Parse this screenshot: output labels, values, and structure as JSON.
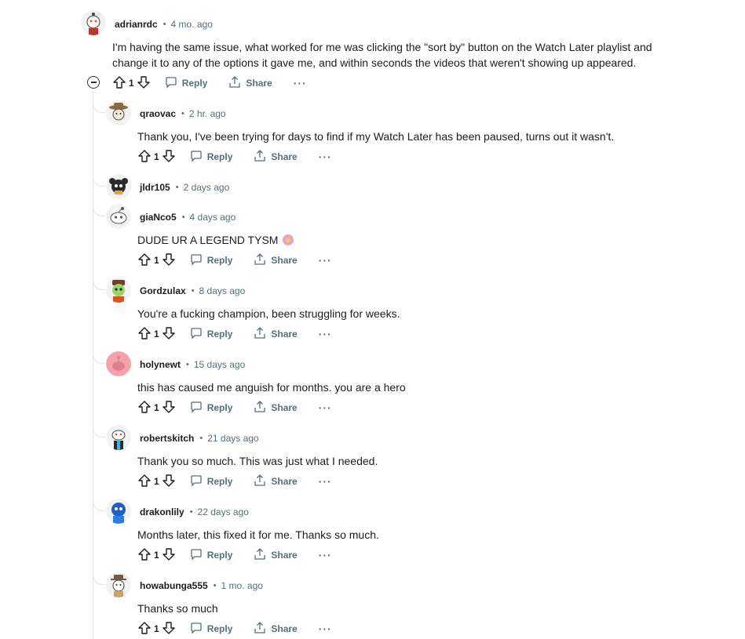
{
  "top_comment": {
    "user": "adrianrdc",
    "time": "4 mo. ago",
    "lines": [
      "I'm having the same issue, what worked for me was clicking the \"sort by\" button on the Watch Later playlist and",
      "change it to any of the options it gave me, and within seconds the videos that weren't showing up appeared."
    ],
    "votes": "1",
    "reply_label": "Reply",
    "share_label": "Share",
    "more_label": "···"
  },
  "replies": [
    {
      "user": "qraovac",
      "time": "2 hr. ago",
      "text": "Thank you, I've been trying for days to find if my Watch Later has been paused, turns out it wasn't.",
      "votes": "1"
    },
    {
      "user": "jldr105",
      "time": "2 days ago",
      "text": "",
      "votes": ""
    },
    {
      "user": "giaNco5",
      "time": "4 days ago",
      "text": "DUDE UR A LEGEND TYSM",
      "votes": "1"
    },
    {
      "user": "Gordzulax",
      "time": "8 days ago",
      "text": "You're a fucking champion, been struggling for weeks.",
      "votes": "1"
    },
    {
      "user": "holynewt",
      "time": "15 days ago",
      "text": "this has caused me anguish for months. you are a hero",
      "votes": "1"
    },
    {
      "user": "robertskitch",
      "time": "21 days ago",
      "text": "Thank you so much. This was just what I needed.",
      "votes": "1"
    },
    {
      "user": "drakonlily",
      "time": "22 days ago",
      "text": "Months later, this fixed it for me. Thanks so much.",
      "votes": "1"
    },
    {
      "user": "howabunga555",
      "time": "1 mo. ago",
      "text": "Thanks so much",
      "votes": "1"
    }
  ],
  "labels": {
    "reply": "Reply",
    "share": "Share",
    "more": "···"
  },
  "colors": {
    "meta": "#576f76",
    "text": "#1c1c1c",
    "thread_line": "#e3e3e3"
  },
  "icons": [
    "upvote-icon",
    "downvote-icon",
    "comment-bubble-icon",
    "share-icon",
    "collapse-icon",
    "more-icon"
  ]
}
